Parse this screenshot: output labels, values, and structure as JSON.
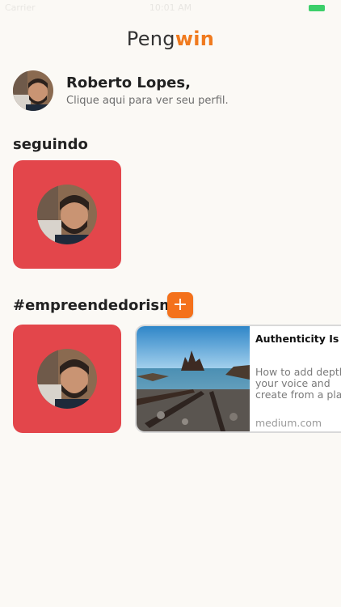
{
  "status": {
    "carrier": "Carrier",
    "time": "10:01 AM"
  },
  "app": {
    "title_a": "Peng",
    "title_b": "win"
  },
  "profile": {
    "name": "Roberto Lopes,",
    "subtitle": "Clique aqui para ver seu perfil."
  },
  "following": {
    "title": "seguindo"
  },
  "tag_section": {
    "title": "#empreendedorismo",
    "add_label": "+"
  },
  "article": {
    "title": "Authenticity Is Your Now",
    "description": "How to add depth to your voice and create from a place that",
    "source": "medium.com"
  },
  "colors": {
    "brand_orange": "#f07a1e",
    "card_red": "#e3464b",
    "battery_green": "#3ccf6a"
  },
  "icons": [
    "plus-icon"
  ]
}
